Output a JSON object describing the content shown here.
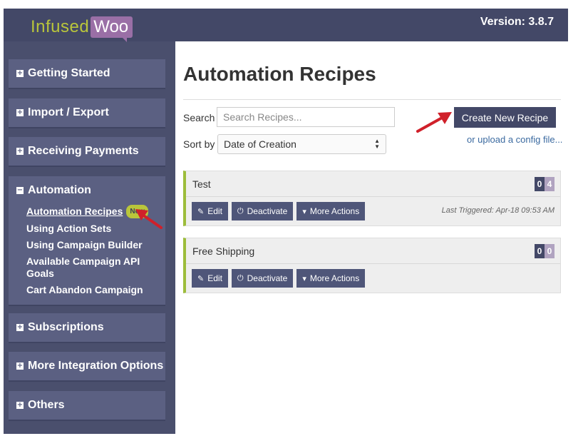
{
  "header": {
    "logo_part1": "Infused",
    "logo_part2": "Woo",
    "version": "Version: 3.8.7"
  },
  "sidebar": {
    "sections": [
      {
        "label": "Getting Started",
        "toggle": "+"
      },
      {
        "label": "Import / Export",
        "toggle": "+"
      },
      {
        "label": "Receiving Payments",
        "toggle": "+"
      },
      {
        "label": "Automation",
        "toggle": "−",
        "items": [
          {
            "label": "Automation Recipes",
            "badge": "New"
          },
          {
            "label": "Using Action Sets"
          },
          {
            "label": "Using Campaign Builder"
          },
          {
            "label": "Available Campaign API Goals"
          },
          {
            "label": "Cart Abandon Campaign"
          }
        ]
      },
      {
        "label": "Subscriptions",
        "toggle": "+"
      },
      {
        "label": "More Integration Options",
        "toggle": "+"
      },
      {
        "label": "Others",
        "toggle": "+"
      }
    ]
  },
  "main": {
    "title": "Automation Recipes",
    "search_label": "Search",
    "search_placeholder": "Search Recipes...",
    "sort_label": "Sort by",
    "sort_value": "Date of Creation",
    "create_button": "Create New Recipe",
    "upload_link": "or upload a config file...",
    "action_labels": {
      "edit": "Edit",
      "deactivate": "Deactivate",
      "more": "More Actions"
    },
    "recipes": [
      {
        "name": "Test",
        "count_a": "0",
        "count_b": "4",
        "last_triggered": "Last Triggered: Apr-18 09:53 AM"
      },
      {
        "name": "Free Shipping",
        "count_a": "0",
        "count_b": "0",
        "last_triggered": ""
      }
    ]
  },
  "colors": {
    "header_bg": "#434867",
    "sidebar_bg": "#4a4f6d",
    "nav_item_bg": "#5b6082",
    "accent_green": "#b9c63b",
    "logo_purple": "#9a6fa6",
    "recipe_border": "#9dbd3b",
    "annotation_arrow": "#d0202a"
  }
}
